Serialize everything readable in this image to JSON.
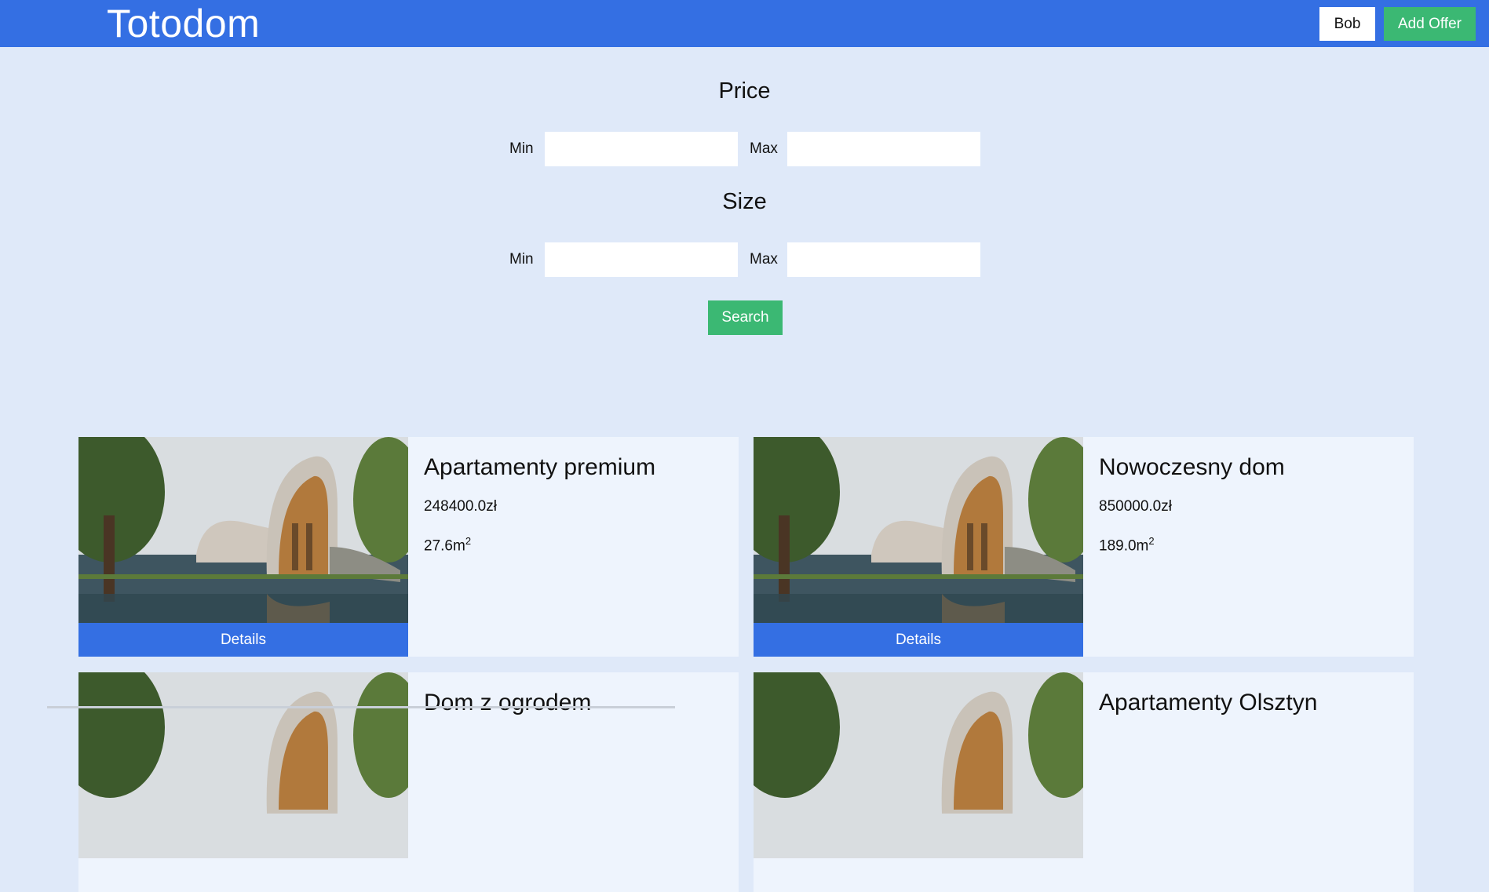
{
  "header": {
    "logo": "Totodom",
    "user_label": "Bob",
    "add_offer_label": "Add Offer",
    "colors": {
      "bar": "#346fe3",
      "accent_green": "#3bb873"
    }
  },
  "filters": {
    "price": {
      "title": "Price",
      "min_label": "Min",
      "max_label": "Max",
      "min_value": "",
      "max_value": ""
    },
    "size": {
      "title": "Size",
      "min_label": "Min",
      "max_label": "Max",
      "min_value": "",
      "max_value": ""
    },
    "search_label": "Search"
  },
  "listings": [
    {
      "title": "Apartamenty premium",
      "price": "248400.0zł",
      "size": "27.6m",
      "size_unit_exp": "2",
      "details_label": "Details",
      "image": "modern-house-photo"
    },
    {
      "title": "Nowoczesny dom",
      "price": "850000.0zł",
      "size": "189.0m",
      "size_unit_exp": "2",
      "details_label": "Details",
      "image": "modern-house-photo"
    },
    {
      "title": "Dom z ogrodem",
      "image": "modern-house-photo"
    },
    {
      "title": "Apartamenty Olsztyn",
      "image": "modern-house-photo"
    }
  ]
}
